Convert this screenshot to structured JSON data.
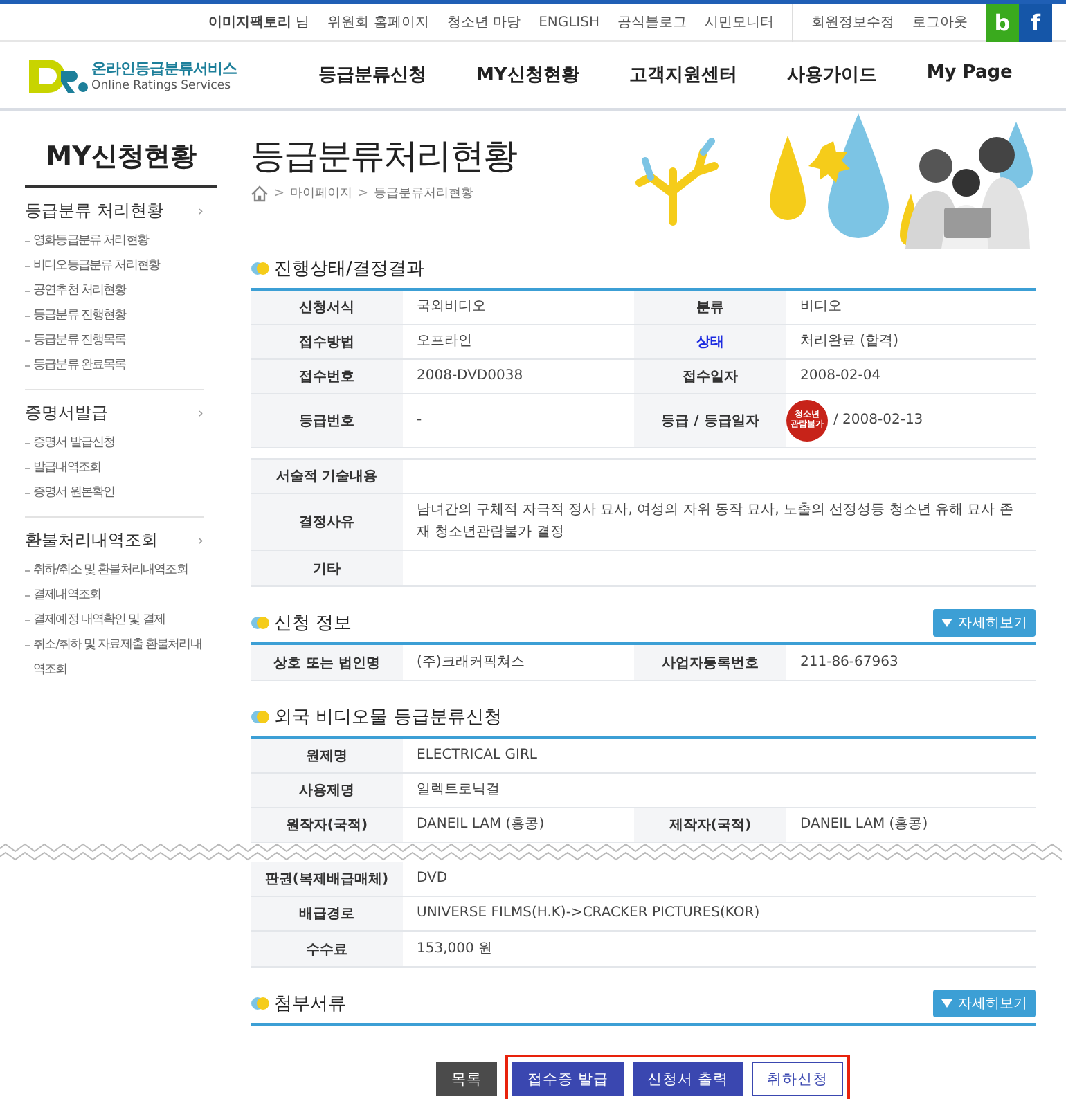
{
  "top_bar": {
    "user": "**이미지팩토리** 님",
    "links": [
      "위원회 홈페이지",
      "청소년 마당",
      "ENGLISH",
      "공식블로그",
      "시민모니터"
    ],
    "account_links": [
      "회원정보수정",
      "로그아웃"
    ],
    "social": [
      {
        "label": "b",
        "color": "#3aaa1e"
      },
      {
        "label": "f",
        "color": "#1556a8"
      }
    ]
  },
  "logo": {
    "name": "온라인등급분류서비스",
    "subtitle": "Online Ratings Services"
  },
  "nav": [
    "등급분류신청",
    "MY신청현황",
    "고객지원센터",
    "사용가이드",
    "My Page"
  ],
  "sidebar": {
    "title": "MY신청현황",
    "groups": [
      {
        "label": "등급분류 처리현황",
        "arrow": "›",
        "items": [
          "영화등급분류 처리현황",
          "비디오등급분류 처리현황",
          "공연추천 처리현황",
          "등급분류 진행현황",
          "등급분류 진행목록",
          "등급분류 완료목록"
        ]
      },
      {
        "label": "증명서발급",
        "arrow": "›",
        "items": [
          "증명서 발급신청",
          "발급내역조회",
          "증명서 원본확인"
        ]
      },
      {
        "label": "환불처리내역조회",
        "arrow": "›",
        "items": [
          "취하/취소 및 환불처리내역조회",
          "결제내역조회",
          "결제예정 내역확인 및 결제",
          "취소/취하 및 자료제출 환불처리내역조회"
        ]
      }
    ]
  },
  "page": {
    "title": "등급분류처리현황",
    "breadcrumb": [
      "마이페이지",
      "등급분류처리현황"
    ],
    "separator": ">"
  },
  "sections": [
    {
      "title": "진행상태/결정결과",
      "tables": [
        [
          {
            "cells": [
              {
                "label": "신청서식",
                "value": "국외비디오"
              },
              {
                "label": "분류",
                "value": "비디오"
              }
            ]
          },
          {
            "cells": [
              {
                "label": "접수방법",
                "value": "오프라인"
              },
              {
                "label": "상태",
                "accent": true,
                "value": "처리완료 (합격)"
              }
            ]
          },
          {
            "cells": [
              {
                "label": "접수번호",
                "value": "2008-DVD0038"
              },
              {
                "label": "접수일자",
                "value": "2008-02-04"
              }
            ]
          },
          {
            "cells": [
              {
                "label": "등급번호",
                "value": "-"
              },
              {
                "label": "등급 / 등급일자",
                "badge": "청소년 관람불가",
                "value": "/ 2008-02-13"
              }
            ]
          }
        ],
        [
          {
            "cells": [
              {
                "label": "서술적 기술내용"
              }
            ]
          },
          {
            "cells": [
              {
                "label": "결정사유",
                "value": "남녀간의 구체적 자극적 정사 묘사, 여성의 자위 동작 묘사, 노출의 선정성등 청소년 유해 묘사 존재 청소년관람불가 결정"
              }
            ]
          },
          {
            "cells": [
              {
                "label": "기타"
              }
            ]
          }
        ]
      ]
    },
    {
      "title": "신청 정보",
      "more": "자세히보기",
      "tables": [
        [
          {
            "cells": [
              {
                "label": "상호 또는 법인명",
                "value": "(주)크래커픽쳐스"
              },
              {
                "label": "사업자등록번호",
                "value": "211-86-67963"
              }
            ]
          }
        ]
      ]
    },
    {
      "title": "외국 비디오물 등급분류신청",
      "tables": [
        [
          {
            "cells": [
              {
                "label": "원제명",
                "value": "ELECTRICAL GIRL"
              }
            ]
          },
          {
            "cells": [
              {
                "label": "사용제명",
                "value": "일렉트로닉걸"
              }
            ]
          },
          {
            "cells": [
              {
                "label": "원작자(국적)",
                "value": "DANEIL LAM (홍콩)"
              },
              {
                "label": "제작자(국적)",
                "value": "DANEIL LAM (홍콩)"
              }
            ],
            "tear_after": true
          },
          {
            "cells": [
              {
                "label": "판권(복제배급매체)",
                "value": "DVD"
              }
            ]
          },
          {
            "cells": [
              {
                "label": "배급경로",
                "value": "UNIVERSE FILMS(H.K)->CRACKER PICTURES(KOR)"
              }
            ]
          },
          {
            "cells": [
              {
                "label": "수수료",
                "value": "153,000 원"
              }
            ]
          }
        ]
      ]
    },
    {
      "title": "첨부서류",
      "more": "자세히보기"
    }
  ],
  "buttons": [
    {
      "label": "목록",
      "kind": "dark",
      "highlighted": false
    },
    {
      "label": "접수증 발급",
      "kind": "primary",
      "highlighted": true
    },
    {
      "label": "신청서 출력",
      "kind": "primary",
      "highlighted": true
    },
    {
      "label": "취하신청",
      "kind": "outline",
      "highlighted": true
    }
  ]
}
